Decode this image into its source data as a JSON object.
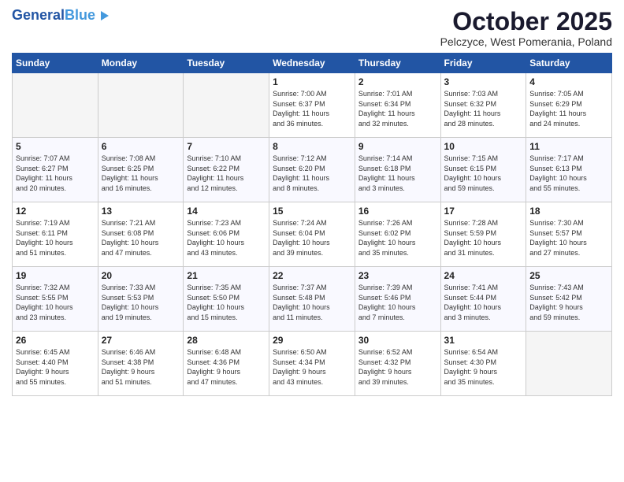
{
  "logo": {
    "general": "General",
    "blue": "Blue"
  },
  "title": "October 2025",
  "location": "Pelczyce, West Pomerania, Poland",
  "weekdays": [
    "Sunday",
    "Monday",
    "Tuesday",
    "Wednesday",
    "Thursday",
    "Friday",
    "Saturday"
  ],
  "weeks": [
    [
      {
        "day": "",
        "info": ""
      },
      {
        "day": "",
        "info": ""
      },
      {
        "day": "",
        "info": ""
      },
      {
        "day": "1",
        "info": "Sunrise: 7:00 AM\nSunset: 6:37 PM\nDaylight: 11 hours\nand 36 minutes."
      },
      {
        "day": "2",
        "info": "Sunrise: 7:01 AM\nSunset: 6:34 PM\nDaylight: 11 hours\nand 32 minutes."
      },
      {
        "day": "3",
        "info": "Sunrise: 7:03 AM\nSunset: 6:32 PM\nDaylight: 11 hours\nand 28 minutes."
      },
      {
        "day": "4",
        "info": "Sunrise: 7:05 AM\nSunset: 6:29 PM\nDaylight: 11 hours\nand 24 minutes."
      }
    ],
    [
      {
        "day": "5",
        "info": "Sunrise: 7:07 AM\nSunset: 6:27 PM\nDaylight: 11 hours\nand 20 minutes."
      },
      {
        "day": "6",
        "info": "Sunrise: 7:08 AM\nSunset: 6:25 PM\nDaylight: 11 hours\nand 16 minutes."
      },
      {
        "day": "7",
        "info": "Sunrise: 7:10 AM\nSunset: 6:22 PM\nDaylight: 11 hours\nand 12 minutes."
      },
      {
        "day": "8",
        "info": "Sunrise: 7:12 AM\nSunset: 6:20 PM\nDaylight: 11 hours\nand 8 minutes."
      },
      {
        "day": "9",
        "info": "Sunrise: 7:14 AM\nSunset: 6:18 PM\nDaylight: 11 hours\nand 3 minutes."
      },
      {
        "day": "10",
        "info": "Sunrise: 7:15 AM\nSunset: 6:15 PM\nDaylight: 10 hours\nand 59 minutes."
      },
      {
        "day": "11",
        "info": "Sunrise: 7:17 AM\nSunset: 6:13 PM\nDaylight: 10 hours\nand 55 minutes."
      }
    ],
    [
      {
        "day": "12",
        "info": "Sunrise: 7:19 AM\nSunset: 6:11 PM\nDaylight: 10 hours\nand 51 minutes."
      },
      {
        "day": "13",
        "info": "Sunrise: 7:21 AM\nSunset: 6:08 PM\nDaylight: 10 hours\nand 47 minutes."
      },
      {
        "day": "14",
        "info": "Sunrise: 7:23 AM\nSunset: 6:06 PM\nDaylight: 10 hours\nand 43 minutes."
      },
      {
        "day": "15",
        "info": "Sunrise: 7:24 AM\nSunset: 6:04 PM\nDaylight: 10 hours\nand 39 minutes."
      },
      {
        "day": "16",
        "info": "Sunrise: 7:26 AM\nSunset: 6:02 PM\nDaylight: 10 hours\nand 35 minutes."
      },
      {
        "day": "17",
        "info": "Sunrise: 7:28 AM\nSunset: 5:59 PM\nDaylight: 10 hours\nand 31 minutes."
      },
      {
        "day": "18",
        "info": "Sunrise: 7:30 AM\nSunset: 5:57 PM\nDaylight: 10 hours\nand 27 minutes."
      }
    ],
    [
      {
        "day": "19",
        "info": "Sunrise: 7:32 AM\nSunset: 5:55 PM\nDaylight: 10 hours\nand 23 minutes."
      },
      {
        "day": "20",
        "info": "Sunrise: 7:33 AM\nSunset: 5:53 PM\nDaylight: 10 hours\nand 19 minutes."
      },
      {
        "day": "21",
        "info": "Sunrise: 7:35 AM\nSunset: 5:50 PM\nDaylight: 10 hours\nand 15 minutes."
      },
      {
        "day": "22",
        "info": "Sunrise: 7:37 AM\nSunset: 5:48 PM\nDaylight: 10 hours\nand 11 minutes."
      },
      {
        "day": "23",
        "info": "Sunrise: 7:39 AM\nSunset: 5:46 PM\nDaylight: 10 hours\nand 7 minutes."
      },
      {
        "day": "24",
        "info": "Sunrise: 7:41 AM\nSunset: 5:44 PM\nDaylight: 10 hours\nand 3 minutes."
      },
      {
        "day": "25",
        "info": "Sunrise: 7:43 AM\nSunset: 5:42 PM\nDaylight: 9 hours\nand 59 minutes."
      }
    ],
    [
      {
        "day": "26",
        "info": "Sunrise: 6:45 AM\nSunset: 4:40 PM\nDaylight: 9 hours\nand 55 minutes."
      },
      {
        "day": "27",
        "info": "Sunrise: 6:46 AM\nSunset: 4:38 PM\nDaylight: 9 hours\nand 51 minutes."
      },
      {
        "day": "28",
        "info": "Sunrise: 6:48 AM\nSunset: 4:36 PM\nDaylight: 9 hours\nand 47 minutes."
      },
      {
        "day": "29",
        "info": "Sunrise: 6:50 AM\nSunset: 4:34 PM\nDaylight: 9 hours\nand 43 minutes."
      },
      {
        "day": "30",
        "info": "Sunrise: 6:52 AM\nSunset: 4:32 PM\nDaylight: 9 hours\nand 39 minutes."
      },
      {
        "day": "31",
        "info": "Sunrise: 6:54 AM\nSunset: 4:30 PM\nDaylight: 9 hours\nand 35 minutes."
      },
      {
        "day": "",
        "info": ""
      }
    ]
  ]
}
